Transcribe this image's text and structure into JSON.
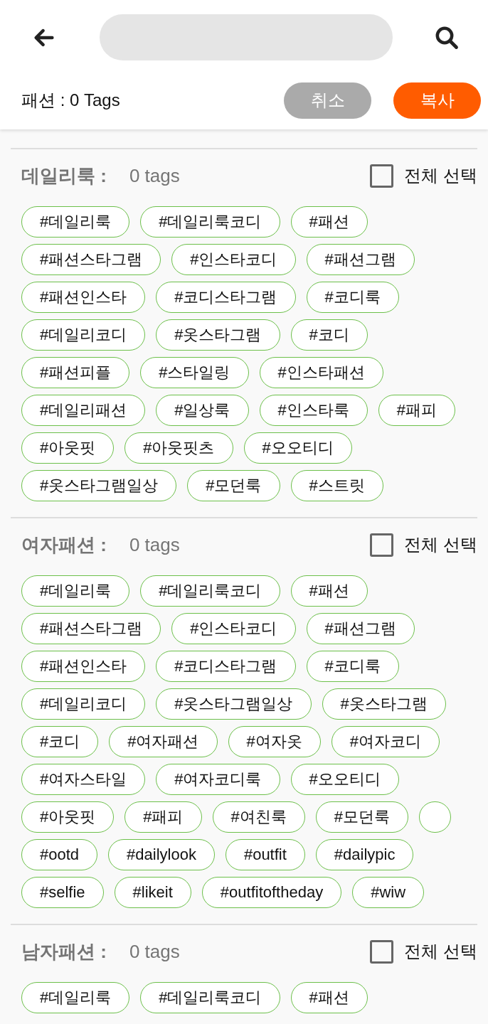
{
  "toolbar": {
    "title": "패션 : 0 Tags",
    "buttons": [
      {
        "kind": "secondary",
        "label": "취소"
      },
      {
        "kind": "primary",
        "label": "복사"
      }
    ]
  },
  "sections": [
    {
      "name": "데일리룩 :",
      "count": "0 tags",
      "select_all": {
        "label": "전체 선택",
        "checked": false
      },
      "tag_rows": [
        [
          {
            "kind": "tag",
            "label": "#데일리룩"
          },
          {
            "kind": "tag",
            "label": "#데일리룩코디"
          },
          {
            "kind": "tag",
            "label": "#패션"
          }
        ],
        [
          {
            "kind": "tag",
            "label": "#패션스타그램"
          },
          {
            "kind": "tag",
            "label": "#인스타코디"
          },
          {
            "kind": "tag",
            "label": "#패션그램"
          }
        ],
        [
          {
            "kind": "tag",
            "label": "#패션인스타"
          },
          {
            "kind": "tag",
            "label": "#코디스타그램"
          },
          {
            "kind": "tag",
            "label": "#코디룩"
          }
        ],
        [
          {
            "kind": "tag",
            "label": "#데일리코디"
          },
          {
            "kind": "tag",
            "label": "#옷스타그램"
          },
          {
            "kind": "tag",
            "label": "#코디"
          }
        ],
        [
          {
            "kind": "tag",
            "label": "#패션피플"
          },
          {
            "kind": "tag",
            "label": "#스타일링"
          },
          {
            "kind": "tag",
            "label": "#인스타패션"
          }
        ],
        [
          {
            "kind": "tag",
            "label": "#데일리패션"
          },
          {
            "kind": "tag",
            "label": "#일상룩"
          },
          {
            "kind": "tag",
            "label": "#인스타룩"
          },
          {
            "kind": "tag",
            "label": "#패피"
          }
        ],
        [
          {
            "kind": "tag",
            "label": "#아웃핏"
          },
          {
            "kind": "tag",
            "label": "#아웃핏츠"
          },
          {
            "kind": "tag",
            "label": "#오오티디"
          }
        ],
        [
          {
            "kind": "tag",
            "label": "#옷스타그램일상"
          },
          {
            "kind": "tag",
            "label": "#모던룩"
          },
          {
            "kind": "tag",
            "label": "#스트릿"
          }
        ]
      ]
    },
    {
      "name": "여자패션 :",
      "count": "0 tags",
      "select_all": {
        "label": "전체 선택",
        "checked": false
      },
      "tag_rows": [
        [
          {
            "kind": "tag",
            "label": "#데일리룩"
          },
          {
            "kind": "tag",
            "label": "#데일리룩코디"
          },
          {
            "kind": "tag",
            "label": "#패션"
          }
        ],
        [
          {
            "kind": "tag",
            "label": "#패션스타그램"
          },
          {
            "kind": "tag",
            "label": "#인스타코디"
          },
          {
            "kind": "tag",
            "label": "#패션그램"
          }
        ],
        [
          {
            "kind": "tag",
            "label": "#패션인스타"
          },
          {
            "kind": "tag",
            "label": "#코디스타그램"
          },
          {
            "kind": "tag",
            "label": "#코디룩"
          }
        ],
        [
          {
            "kind": "tag",
            "label": "#데일리코디"
          },
          {
            "kind": "tag",
            "label": "#옷스타그램일상"
          },
          {
            "kind": "tag",
            "label": "#옷스타그램"
          }
        ],
        [
          {
            "kind": "tag",
            "label": "#코디"
          },
          {
            "kind": "tag",
            "label": "#여자패션"
          },
          {
            "kind": "tag",
            "label": "#여자옷"
          },
          {
            "kind": "tag",
            "label": "#여자코디"
          }
        ],
        [
          {
            "kind": "tag",
            "label": "#여자스타일"
          },
          {
            "kind": "tag",
            "label": "#여자코디룩"
          },
          {
            "kind": "tag",
            "label": "#오오티디"
          }
        ],
        [
          {
            "kind": "tag",
            "label": "#아웃핏"
          },
          {
            "kind": "tag",
            "label": "#패피"
          },
          {
            "kind": "tag",
            "label": "#여친룩"
          },
          {
            "kind": "tag",
            "label": "#모던룩"
          },
          {
            "kind": "blank"
          }
        ],
        [
          {
            "kind": "tag",
            "label": "#ootd"
          },
          {
            "kind": "tag",
            "label": "#dailylook"
          },
          {
            "kind": "tag",
            "label": "#outfit"
          },
          {
            "kind": "tag",
            "label": "#dailypic"
          }
        ],
        [
          {
            "kind": "tag",
            "label": "#selfie"
          },
          {
            "kind": "tag",
            "label": "#likeit"
          },
          {
            "kind": "tag",
            "label": "#outfitoftheday"
          },
          {
            "kind": "tag",
            "label": "#wiw"
          }
        ]
      ]
    },
    {
      "name": "남자패션 :",
      "count": "0 tags",
      "select_all": {
        "label": "전체 선택",
        "checked": false
      },
      "tag_rows": [
        [
          {
            "kind": "tag",
            "label": "#데일리룩"
          },
          {
            "kind": "tag",
            "label": "#데일리룩코디"
          },
          {
            "kind": "tag",
            "label": "#패션"
          }
        ]
      ]
    }
  ]
}
